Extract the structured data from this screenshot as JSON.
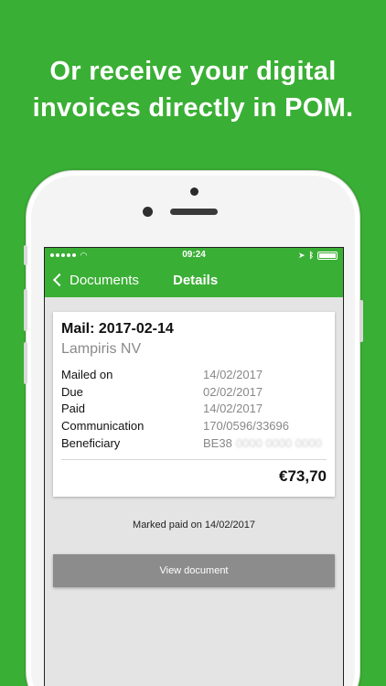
{
  "headline": {
    "line1": "Or receive your digital",
    "line2": "invoices directly in POM."
  },
  "status_bar": {
    "time": "09:24"
  },
  "nav": {
    "back_label": "Documents",
    "title": "Details"
  },
  "document": {
    "title": "Mail: 2017-02-14",
    "issuer": "Lampiris NV",
    "fields": [
      {
        "label": "Mailed on",
        "value": "14/02/2017"
      },
      {
        "label": "Due",
        "value": "02/02/2017"
      },
      {
        "label": "Paid",
        "value": "14/02/2017"
      },
      {
        "label": "Communication",
        "value": "170/0596/33696"
      },
      {
        "label": "Beneficiary",
        "value": "BE38",
        "blurred": "0000 0000 0000"
      }
    ],
    "amount": "€73,70"
  },
  "paid_note": "Marked paid on 14/02/2017",
  "view_button_label": "View document",
  "colors": {
    "brand_green": "#3aaf35",
    "button_gray": "#8c8c8c"
  }
}
